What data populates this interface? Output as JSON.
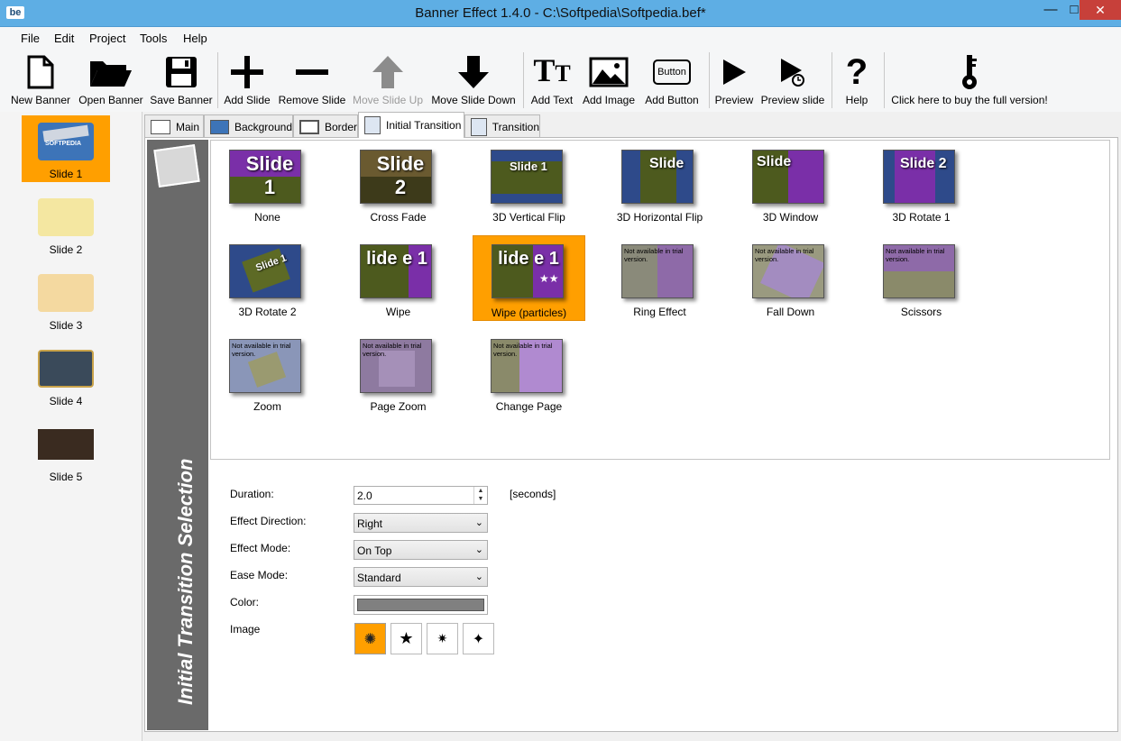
{
  "window": {
    "app_icon": "be",
    "title": "Banner Effect 1.4.0 -  C:\\Softpedia\\Softpedia.bef*",
    "minimize": "—",
    "maximize": "□",
    "close": "✕"
  },
  "menu": [
    "File",
    "Edit",
    "Project",
    "Tools",
    "Help"
  ],
  "toolbar": {
    "new_banner": "New Banner",
    "open_banner": "Open Banner",
    "save_banner": "Save Banner",
    "add_slide": "Add Slide",
    "remove_slide": "Remove Slide",
    "move_slide_up": "Move Slide Up",
    "move_slide_down": "Move Slide Down",
    "add_text": "Add Text",
    "add_image": "Add Image",
    "add_button": "Add Button",
    "add_button_icon_text": "Button",
    "preview": "Preview",
    "preview_slide": "Preview slide",
    "help": "Help",
    "buy": "Click here to buy the full version!"
  },
  "slides": [
    {
      "label": "Slide 1",
      "active": true,
      "thumb_color": "#3d74b8"
    },
    {
      "label": "Slide 2",
      "active": false,
      "thumb_color": "#f4e7a1"
    },
    {
      "label": "Slide 3",
      "active": false,
      "thumb_color": "#f4d9a0"
    },
    {
      "label": "Slide 4",
      "active": false,
      "thumb_color": "#3a4a5a"
    },
    {
      "label": "Slide 5",
      "active": false,
      "thumb_color": "#3a2b20"
    }
  ],
  "slide1_thumb_text": "SOFTPEDIA",
  "tabs": {
    "main": "Main",
    "background": "Background",
    "border": "Border",
    "initial_transition": "Initial Transition",
    "transition": "Transition"
  },
  "side_title": "Initial Transition Selection",
  "transitions": {
    "none": {
      "label": "None",
      "preview": "Slide 1"
    },
    "cross_fade": {
      "label": "Cross Fade",
      "preview": "Slide 2"
    },
    "v_flip": {
      "label": "3D Vertical Flip",
      "preview": "Slide 1"
    },
    "h_flip": {
      "label": "3D Horizontal Flip",
      "preview": "Slide"
    },
    "window": {
      "label": "3D Window",
      "preview": "Slide"
    },
    "rotate1": {
      "label": "3D Rotate 1",
      "preview": "Slide 2"
    },
    "rotate2": {
      "label": "3D Rotate 2",
      "preview": "Slide 1"
    },
    "wipe": {
      "label": "Wipe",
      "preview": "lide e 1"
    },
    "wipe_particles": {
      "label": "Wipe (particles)",
      "preview": "lide e 1"
    },
    "ring": {
      "label": "Ring Effect",
      "preview": "Not available in trial version."
    },
    "fall_down": {
      "label": "Fall Down",
      "preview": "Not available in trial version."
    },
    "scissors": {
      "label": "Scissors",
      "preview": "Not available in trial version."
    },
    "zoom": {
      "label": "Zoom",
      "preview": "Not available in trial version."
    },
    "page_zoom": {
      "label": "Page Zoom",
      "preview": "Not available in trial version."
    },
    "change_page": {
      "label": "Change Page",
      "preview": "Not available in trial version."
    }
  },
  "form": {
    "duration_label": "Duration:",
    "duration_value": "2.0",
    "duration_unit": "[seconds]",
    "direction_label": "Effect Direction:",
    "direction_value": "Right",
    "mode_label": "Effect Mode:",
    "mode_value": "On Top",
    "ease_label": "Ease Mode:",
    "ease_value": "Standard",
    "color_label": "Color:",
    "color_value": "#808080",
    "image_label": "Image"
  },
  "image_options": [
    "splat-icon",
    "star-icon",
    "burst-icon",
    "sparkle-icon"
  ],
  "colors": {
    "accent": "#ff9f00",
    "titlebar": "#5eaee4",
    "close": "#c7403a",
    "purple": "#7a2fa8",
    "grass": "#4d5a1e"
  }
}
